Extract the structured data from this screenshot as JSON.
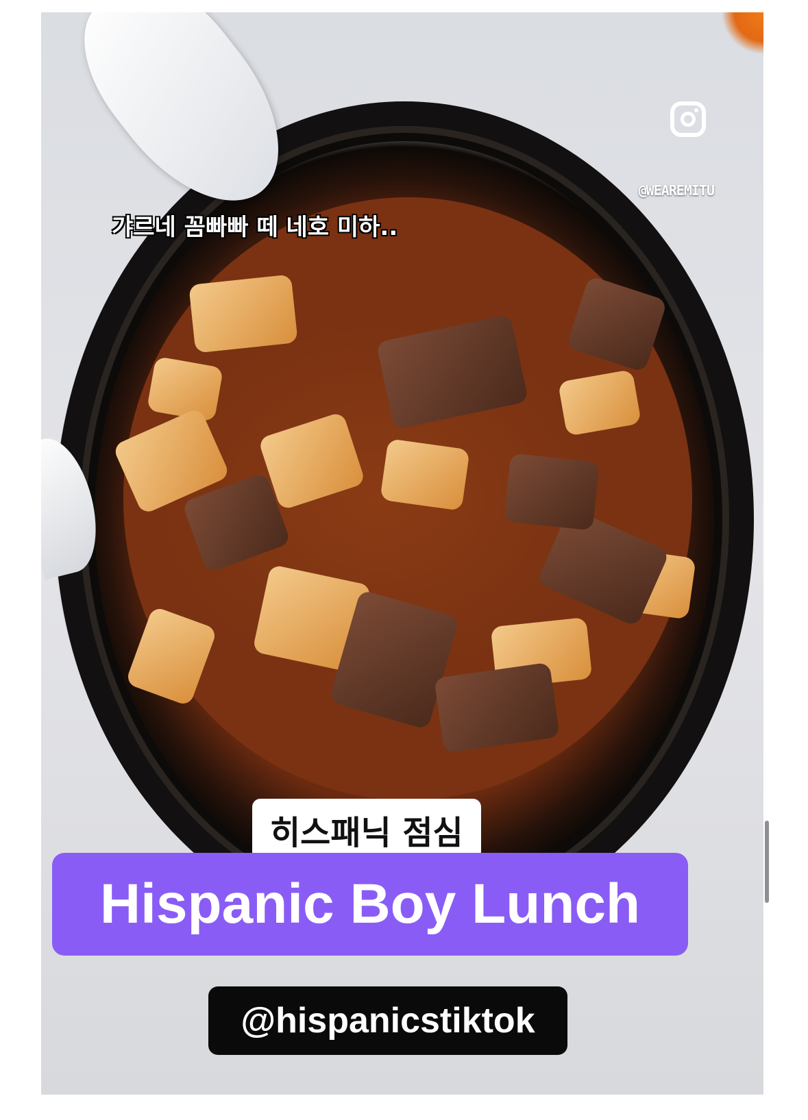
{
  "video": {
    "caption_top": "갸르네 꼼빠빠 떼 네호 미하..",
    "watermark_handle": "@WEAREMITU",
    "watermark_icon": "instagram-icon",
    "subtitle_korean": "히스패닉 점심",
    "title": "Hispanic Boy Lunch",
    "source_tag": "@hispanicstiktok"
  },
  "colors": {
    "title_background": "#8a5cf6",
    "tag_background": "#0a0a0a",
    "subtitle_background": "#ffffff"
  }
}
